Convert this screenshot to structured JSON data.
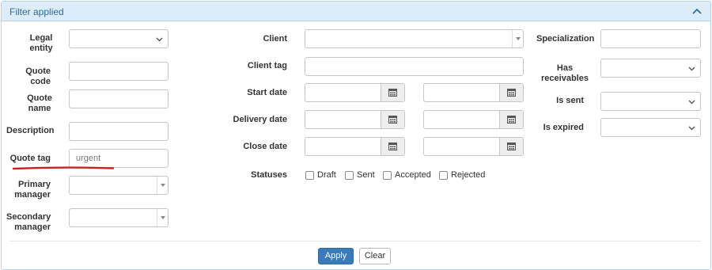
{
  "panel": {
    "title": "Filter applied",
    "collapse_icon": "chevron-up-icon"
  },
  "left_column": {
    "legal_entity": {
      "label": "Legal entity",
      "value": ""
    },
    "quote_code": {
      "label": "Quote code",
      "value": ""
    },
    "quote_name": {
      "label": "Quote name",
      "value": ""
    },
    "description": {
      "label": "Description",
      "value": ""
    },
    "quote_tag": {
      "label": "Quote tag",
      "value": "urgent"
    },
    "primary_manager": {
      "label": "Primary manager",
      "value": ""
    },
    "secondary_manager": {
      "label": "Secondary manager",
      "value": ""
    }
  },
  "middle_column": {
    "client": {
      "label": "Client",
      "value": ""
    },
    "client_tag": {
      "label": "Client tag",
      "value": ""
    },
    "start_date": {
      "label": "Start date",
      "from": "",
      "to": ""
    },
    "delivery_date": {
      "label": "Delivery date",
      "from": "",
      "to": ""
    },
    "close_date": {
      "label": "Close date",
      "from": "",
      "to": ""
    },
    "statuses": {
      "label": "Statuses",
      "options": [
        {
          "label": "Draft",
          "checked": false
        },
        {
          "label": "Sent",
          "checked": false
        },
        {
          "label": "Accepted",
          "checked": false
        },
        {
          "label": "Rejected",
          "checked": false
        }
      ]
    }
  },
  "right_column": {
    "specialization": {
      "label": "Specialization",
      "value": ""
    },
    "has_receivables": {
      "label": "Has receivables",
      "value": ""
    },
    "is_sent": {
      "label": "Is sent",
      "value": ""
    },
    "is_expired": {
      "label": "Is expired",
      "value": ""
    }
  },
  "actions": {
    "apply_label": "Apply",
    "clear_label": "Clear"
  },
  "colors": {
    "header_bg": "#dcecf8",
    "title_color": "#2d6ea0",
    "apply_bg": "#3a7ab8",
    "highlight_underline": "#cc2222"
  }
}
